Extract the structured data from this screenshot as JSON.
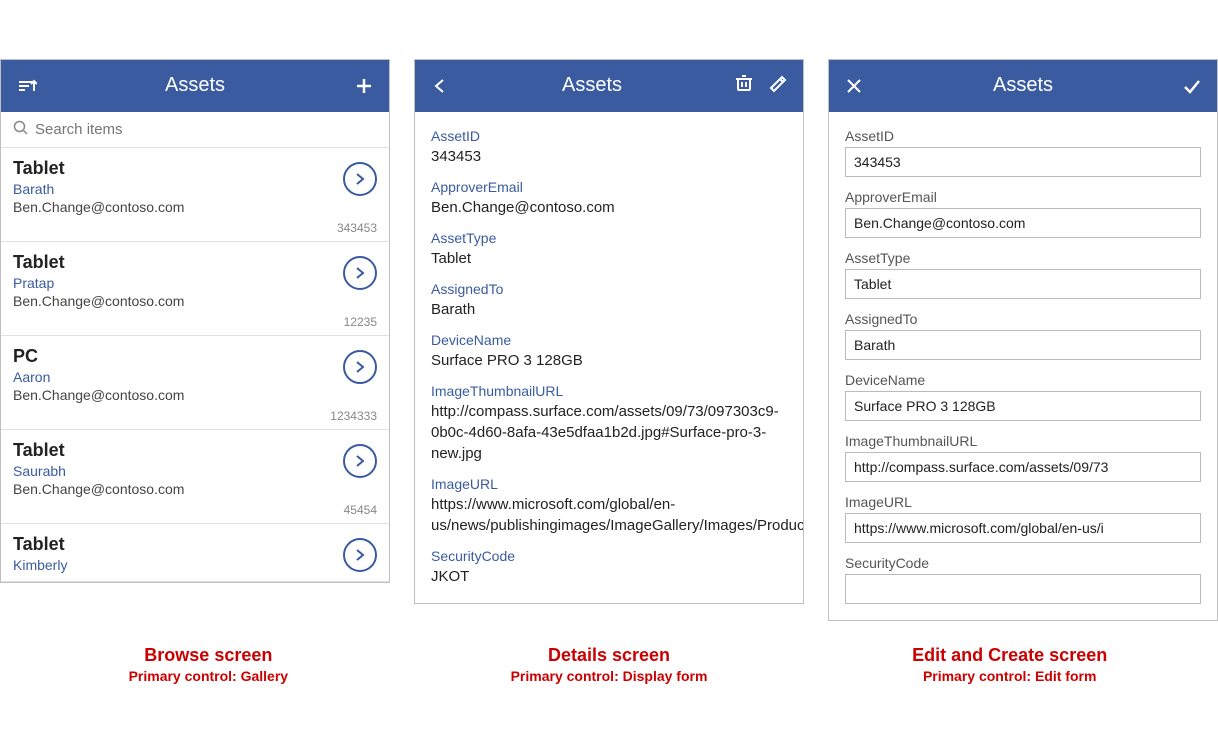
{
  "screens": {
    "browse": {
      "header": {
        "title": "Assets",
        "sort_icon": "sort-icon",
        "add_icon": "add-icon"
      },
      "search": {
        "placeholder": "Search items"
      },
      "items": [
        {
          "title": "Tablet",
          "subtitle": "Barath",
          "email": "Ben.Change@contoso.com",
          "id": "343453"
        },
        {
          "title": "Tablet",
          "subtitle": "Pratap",
          "email": "Ben.Change@contoso.com",
          "id": "12235"
        },
        {
          "title": "PC",
          "subtitle": "Aaron",
          "email": "Ben.Change@contoso.com",
          "id": "1234333"
        },
        {
          "title": "Tablet",
          "subtitle": "Saurabh",
          "email": "Ben.Change@contoso.com",
          "id": "45454"
        },
        {
          "title": "Tablet",
          "subtitle": "Kimberly",
          "email": "",
          "id": ""
        }
      ]
    },
    "details": {
      "header": {
        "title": "Assets",
        "back_icon": "back-icon",
        "delete_icon": "delete-icon",
        "edit_icon": "edit-icon"
      },
      "fields": [
        {
          "label": "AssetID",
          "value": "343453"
        },
        {
          "label": "ApproverEmail",
          "value": "Ben.Change@contoso.com"
        },
        {
          "label": "AssetType",
          "value": "Tablet"
        },
        {
          "label": "AssignedTo",
          "value": "Barath"
        },
        {
          "label": "DeviceName",
          "value": "Surface PRO 3 128GB"
        },
        {
          "label": "ImageThumbnailURL",
          "value": "http://compass.surface.com/assets/09/73/097303c9-0b0c-4d60-8afa-43e5dfaa1b2d.jpg#Surface-pro-3-new.jpg"
        },
        {
          "label": "ImageURL",
          "value": "https://www.microsoft.com/global/en-us/news/publishingimages/ImageGallery/Images/Products/SurfacePro3/SurfacePro3Primary_Print.jpg"
        },
        {
          "label": "SecurityCode",
          "value": "JKOT"
        }
      ]
    },
    "edit": {
      "header": {
        "title": "Assets",
        "close_icon": "close-icon",
        "check_icon": "check-icon"
      },
      "fields": [
        {
          "label": "AssetID",
          "value": "343453"
        },
        {
          "label": "ApproverEmail",
          "value": "Ben.Change@contoso.com"
        },
        {
          "label": "AssetType",
          "value": "Tablet"
        },
        {
          "label": "AssignedTo",
          "value": "Barath"
        },
        {
          "label": "DeviceName",
          "value": "Surface PRO 3 128GB"
        },
        {
          "label": "ImageThumbnailURL",
          "value": "http://compass.surface.com/assets/09/73"
        },
        {
          "label": "ImageURL",
          "value": "https://www.microsoft.com/global/en-us/i"
        },
        {
          "label": "SecurityCode",
          "value": ""
        }
      ]
    }
  },
  "captions": {
    "browse": {
      "title": "Browse screen",
      "sub": "Primary control: Gallery"
    },
    "details": {
      "title": "Details screen",
      "sub": "Primary control: Display form"
    },
    "edit": {
      "title": "Edit and Create screen",
      "sub": "Primary control: Edit form"
    }
  }
}
